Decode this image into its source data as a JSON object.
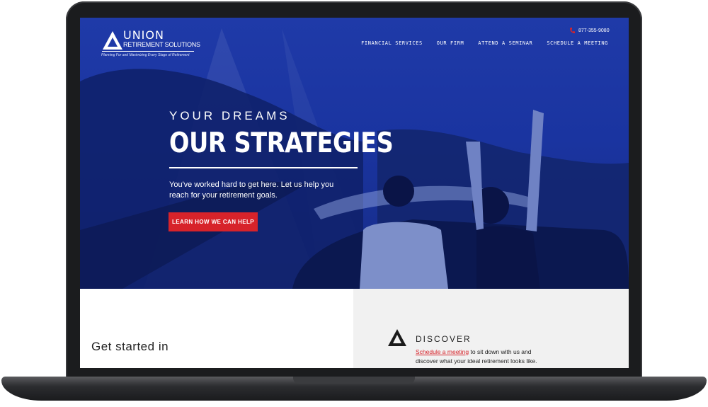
{
  "header": {
    "logo_word": "UNION",
    "logo_sub": "RETIREMENT SOLUTIONS",
    "logo_tagline": "Planning For and Maximizing Every Stage of Retirement",
    "phone": "877-355-9080",
    "nav": [
      "FINANCIAL SERVICES",
      "OUR FIRM",
      "ATTEND A SEMINAR",
      "SCHEDULE A MEETING"
    ]
  },
  "hero": {
    "eyebrow": "YOUR DREAMS",
    "headline": "OUR STRATEGIES",
    "body": "You've worked hard to get here. Let us help you reach for your retirement goals.",
    "cta_label": "LEARN HOW WE CAN HELP"
  },
  "sections": {
    "get_started": "Get started in",
    "discover_title": "DISCOVER",
    "discover_link": "Schedule a meeting",
    "discover_text": " to sit down with us and discover what your ideal retirement looks like."
  },
  "colors": {
    "brand_blue": "#1f3aa8",
    "accent_red": "#d7232a",
    "panel_gray": "#f1f1f1"
  },
  "icons": [
    "phone-icon",
    "union-logo-mark",
    "discover-mark-icon"
  ]
}
